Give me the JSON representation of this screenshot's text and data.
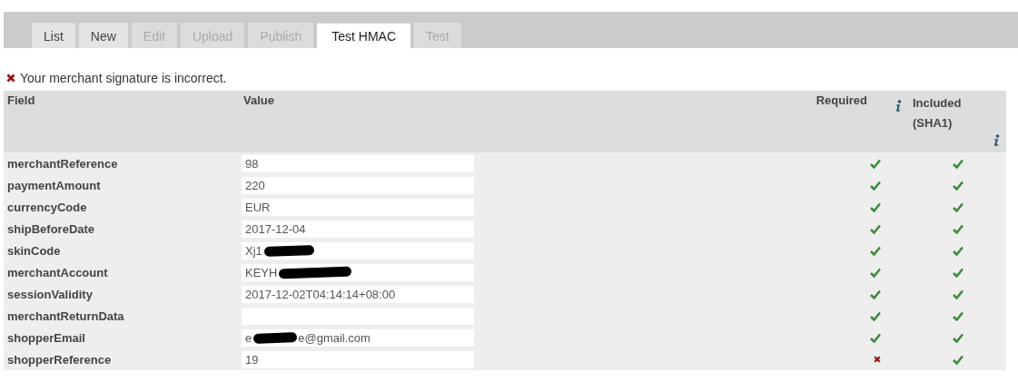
{
  "tabs": [
    {
      "label": "List",
      "selected": false,
      "disabled": false
    },
    {
      "label": "New",
      "selected": false,
      "disabled": false
    },
    {
      "label": "Edit",
      "selected": false,
      "disabled": true
    },
    {
      "label": "Upload",
      "selected": false,
      "disabled": true
    },
    {
      "label": "Publish",
      "selected": false,
      "disabled": true
    },
    {
      "label": "Test HMAC",
      "selected": true,
      "disabled": false
    },
    {
      "label": "Test",
      "selected": false,
      "disabled": true
    }
  ],
  "message": {
    "kind": "error",
    "text": "Your merchant signature is incorrect."
  },
  "table": {
    "columns": {
      "field": "Field",
      "value": "Value",
      "required": "Required",
      "included": "Included (SHA1)"
    },
    "rows": [
      {
        "field": "merchantReference",
        "value": "98",
        "required": true,
        "included": true
      },
      {
        "field": "paymentAmount",
        "value": "220",
        "required": true,
        "included": true
      },
      {
        "field": "currencyCode",
        "value": "EUR",
        "required": true,
        "included": true
      },
      {
        "field": "shipBeforeDate",
        "value": "2017-12-04",
        "required": true,
        "included": true
      },
      {
        "field": "skinCode",
        "value": "Xj1",
        "redacted": true,
        "required": true,
        "included": true
      },
      {
        "field": "merchantAccount",
        "value": "KEYH",
        "redacted": true,
        "required": true,
        "included": true
      },
      {
        "field": "sessionValidity",
        "value": "2017-12-02T04:14:14+08:00",
        "required": true,
        "included": true
      },
      {
        "field": "merchantReturnData",
        "required": true,
        "included": true
      },
      {
        "field": "shopperEmail",
        "value": "e",
        "redacted": true,
        "value_after": "e@gmail.com",
        "required": true,
        "included": true
      },
      {
        "field": "shopperReference",
        "value": "19",
        "required": false,
        "included": true
      }
    ]
  }
}
